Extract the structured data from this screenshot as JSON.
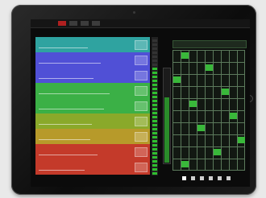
{
  "window": {
    "title": "",
    "clock": ""
  },
  "tracks": [
    {
      "label": "",
      "color": "#2fa3a0",
      "level": 0.55
    },
    {
      "label": "",
      "color": "#5050d6",
      "level": 0.7
    },
    {
      "label": "",
      "color": "#5050d6",
      "level": 0.62
    },
    {
      "label": "",
      "color": "#3bb046",
      "level": 0.8
    },
    {
      "label": "",
      "color": "#3bb046",
      "level": 0.74
    },
    {
      "label": "",
      "color": "#8aa92a",
      "level": 0.6
    },
    {
      "label": "",
      "color": "#b79a2a",
      "level": 0.58
    },
    {
      "label": "",
      "color": "#c43a2a",
      "level": 0.66
    },
    {
      "label": "",
      "color": "#c43a2a",
      "level": 0.52
    }
  ],
  "matrix": {
    "rows": 10,
    "cols": 9,
    "active_cells": [
      [
        0,
        1
      ],
      [
        1,
        4
      ],
      [
        2,
        0
      ],
      [
        3,
        6
      ],
      [
        4,
        2
      ],
      [
        5,
        7
      ],
      [
        6,
        3
      ],
      [
        7,
        8
      ],
      [
        8,
        5
      ],
      [
        9,
        1
      ]
    ]
  },
  "meter": {
    "level": 0.78,
    "color_low": "#2fbf2f",
    "color_high": "#e03030"
  },
  "side_fader": {
    "level": 0.7
  },
  "page_dots": {
    "count": 6,
    "selected": 0
  },
  "brand": {
    "text": ""
  },
  "colors": {
    "accent": "#b02020",
    "grid": "#5c7a5c"
  }
}
